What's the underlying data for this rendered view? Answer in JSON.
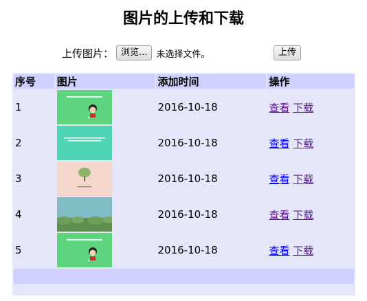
{
  "title": "图片的上传和下载",
  "upload": {
    "label": "上传图片：",
    "browse_label": "浏览...",
    "file_status": "未选择文件。",
    "submit_label": "上传"
  },
  "table": {
    "headers": [
      "序号",
      "图片",
      "添加时间",
      "操作"
    ],
    "rows": [
      {
        "id": "1",
        "date": "2016-10-18",
        "view": "查看",
        "download": "下载",
        "thumb": "green-cartoon-boy"
      },
      {
        "id": "2",
        "date": "2016-10-18",
        "view": "查看",
        "download": "下载",
        "thumb": "teal-text-card"
      },
      {
        "id": "3",
        "date": "2016-10-18",
        "view": "查看",
        "download": "下载",
        "thumb": "pink-tree"
      },
      {
        "id": "4",
        "date": "2016-10-18",
        "view": "查看",
        "download": "下载",
        "thumb": "landscape-trees"
      },
      {
        "id": "5",
        "date": "2016-10-18",
        "view": "查看",
        "download": "下载",
        "thumb": "green-cartoon-boy"
      }
    ]
  },
  "colors": {
    "header_bg": "#d0d0ff",
    "table_bg": "#e6e6fa",
    "link": "#0000ee",
    "visited_link": "#551a8b"
  }
}
